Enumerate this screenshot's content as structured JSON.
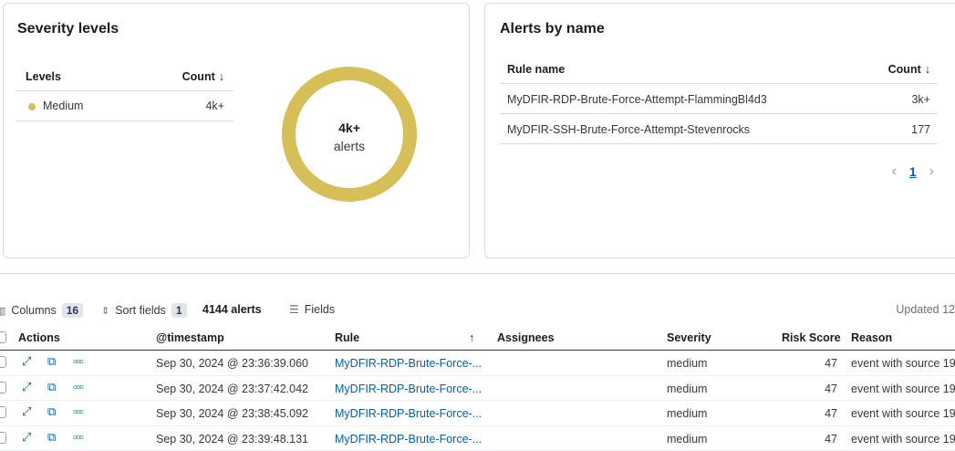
{
  "severity_panel": {
    "title": "Severity levels",
    "col_levels": "Levels",
    "col_count": "Count",
    "rows": [
      {
        "level": "Medium",
        "count": "4k+"
      }
    ],
    "donut_value": "4k+",
    "donut_label": "alerts",
    "donut_color": "#d6bf57"
  },
  "alerts_by_name": {
    "title": "Alerts by name",
    "col_rule": "Rule name",
    "col_count": "Count",
    "rows": [
      {
        "rule": "MyDFIR-RDP-Brute-Force-Attempt-FlammingBl4d3",
        "count": "3k+"
      },
      {
        "rule": "MyDFIR-SSH-Brute-Force-Attempt-Stevenrocks",
        "count": "177"
      }
    ],
    "page": "1"
  },
  "toolbar": {
    "columns_label": "Columns",
    "columns_count": "16",
    "sort_label": "Sort fields",
    "sort_count": "1",
    "alerts_count": "4144 alerts",
    "fields_label": "Fields",
    "updated": "Updated 12"
  },
  "grid": {
    "headers": {
      "actions": "Actions",
      "timestamp": "@timestamp",
      "rule": "Rule",
      "assignees": "Assignees",
      "severity": "Severity",
      "risk": "Risk Score",
      "reason": "Reason"
    },
    "rows": [
      {
        "timestamp": "Sep 30, 2024 @ 23:36:39.060",
        "rule": "MyDFIR-RDP-Brute-Force-...",
        "severity": "medium",
        "risk": "47",
        "reason": "event with source 19"
      },
      {
        "timestamp": "Sep 30, 2024 @ 23:37:42.042",
        "rule": "MyDFIR-RDP-Brute-Force-...",
        "severity": "medium",
        "risk": "47",
        "reason": "event with source 19"
      },
      {
        "timestamp": "Sep 30, 2024 @ 23:38:45.092",
        "rule": "MyDFIR-RDP-Brute-Force-...",
        "severity": "medium",
        "risk": "47",
        "reason": "event with source 19"
      },
      {
        "timestamp": "Sep 30, 2024 @ 23:39:48.131",
        "rule": "MyDFIR-RDP-Brute-Force-...",
        "severity": "medium",
        "risk": "47",
        "reason": "event with source 19"
      }
    ]
  }
}
